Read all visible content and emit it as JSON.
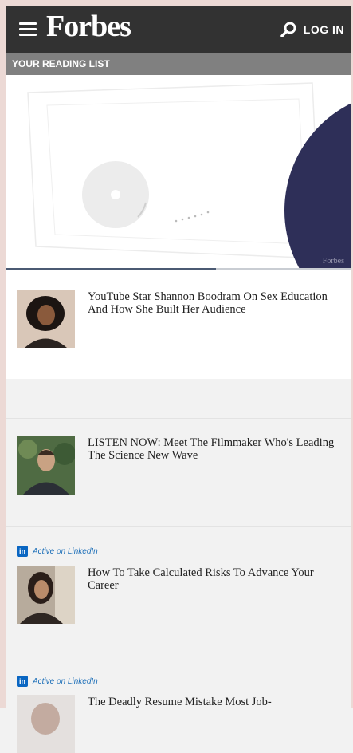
{
  "header": {
    "logo": "Forbes",
    "login_label": "LOG IN"
  },
  "reading_list": {
    "title": "YOUR READING LIST"
  },
  "hero": {
    "watermark": "Forbes",
    "progress_fraction": 0.61
  },
  "articles": [
    {
      "headline": "YouTube Star Shannon Boodram On Sex Education And How She Built Her Audience",
      "source": ""
    },
    {
      "headline": "LISTEN NOW: Meet The Filmmaker Who's Leading The Science New Wave",
      "source": ""
    },
    {
      "headline": "How To Take Calculated Risks To Advance Your Career",
      "source": "Active on LinkedIn"
    },
    {
      "headline": "The Deadly Resume Mistake Most Job-",
      "source": "Active on LinkedIn"
    }
  ],
  "icons": {
    "menu": "hamburger-menu-icon",
    "search": "search-icon",
    "linkedin": "linkedin-icon"
  },
  "colors": {
    "header_bg": "#323232",
    "reading_bar_bg": "#808080",
    "hero_circle": "#2e2f58",
    "linkedin": "#0a66c2"
  }
}
